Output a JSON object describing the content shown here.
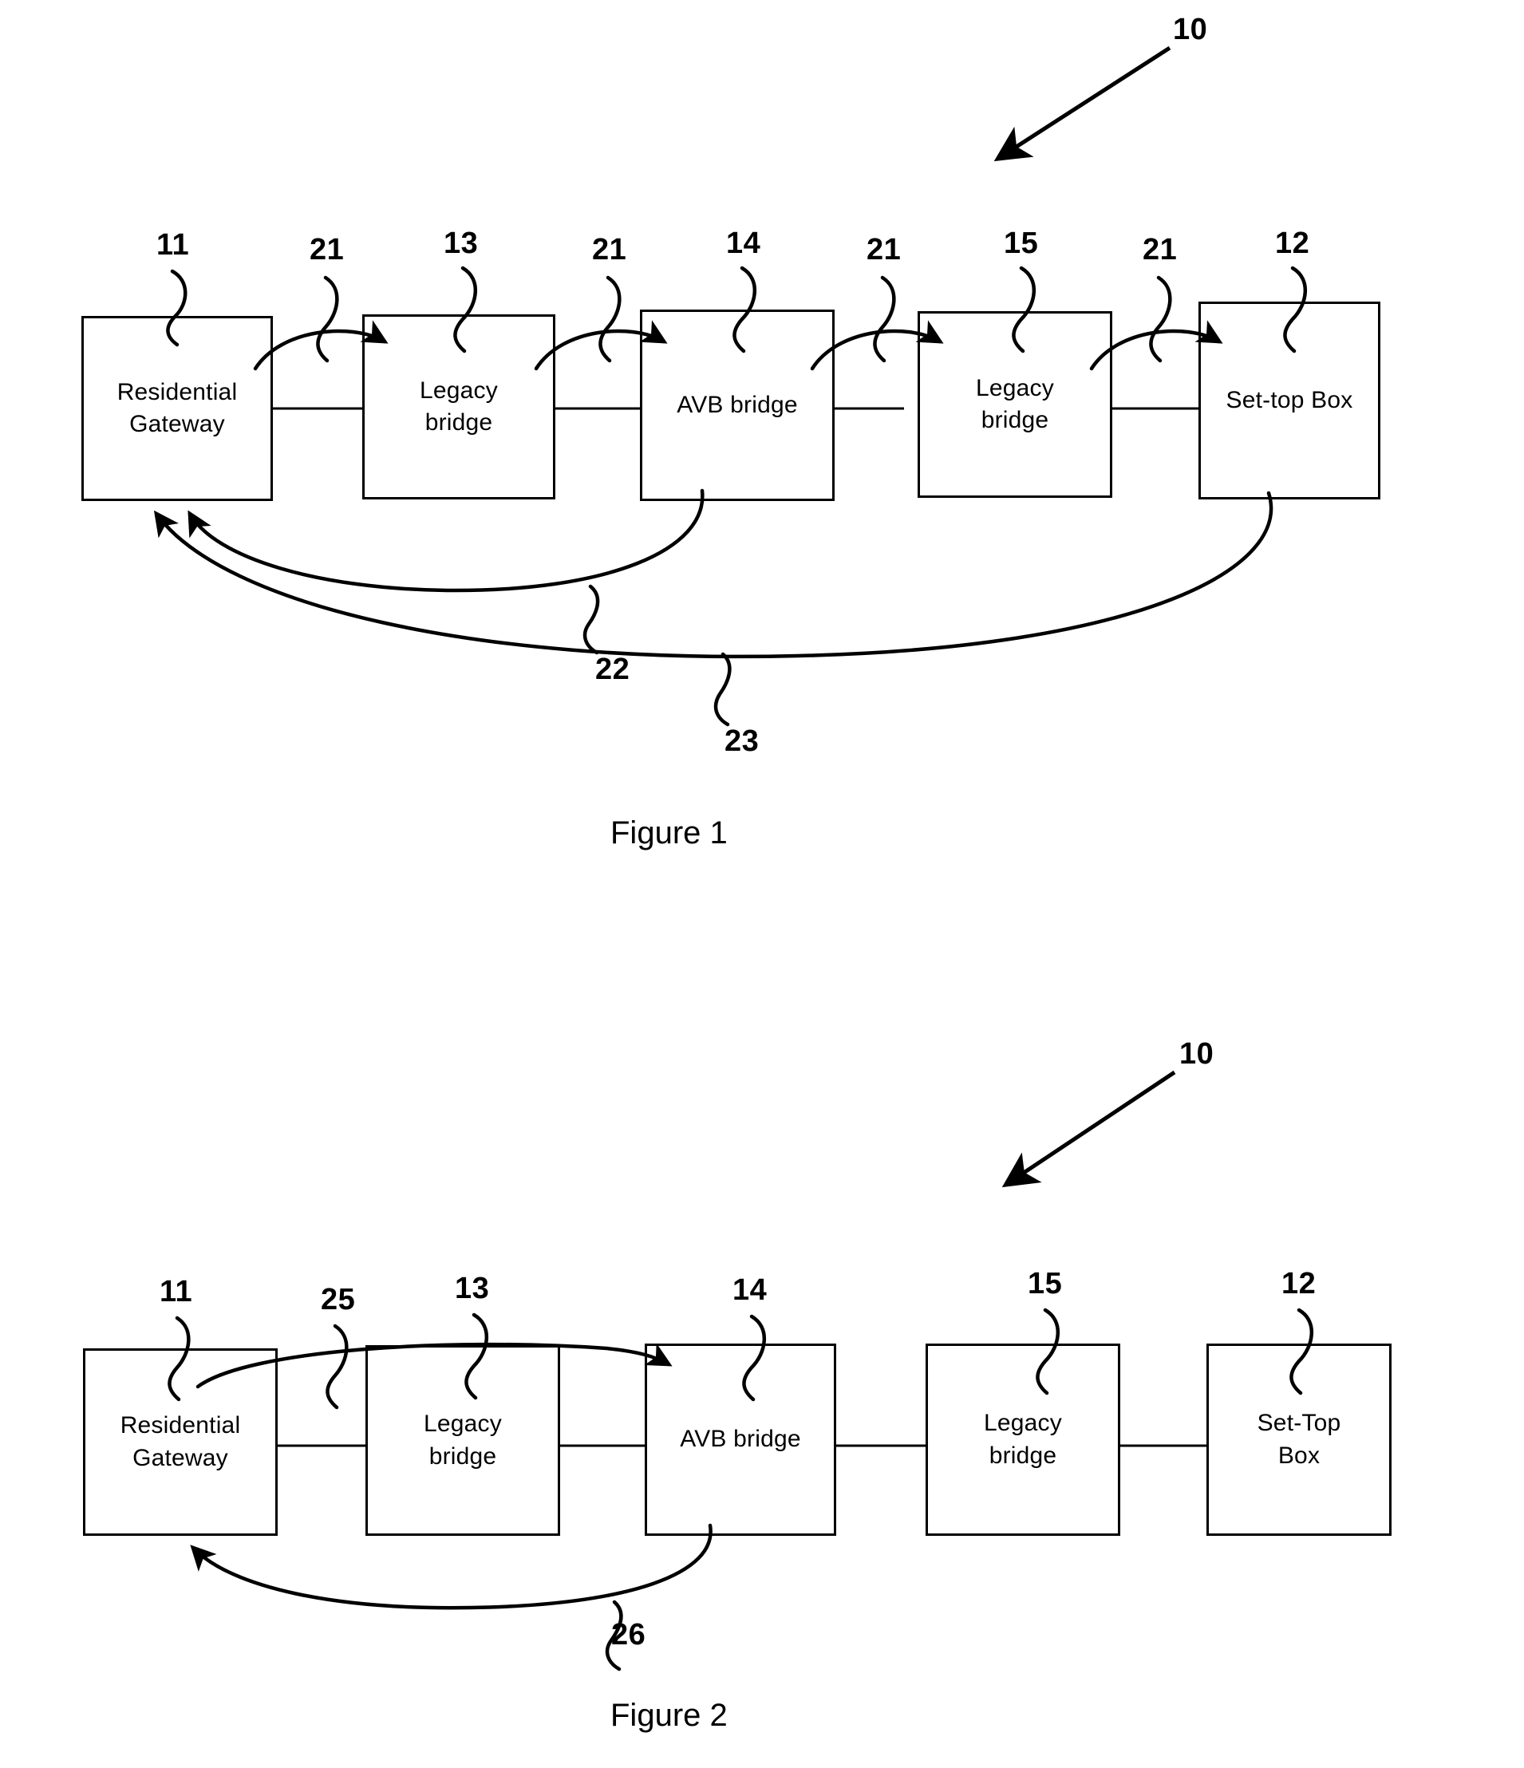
{
  "document": {
    "type": "patent-drawing-sheet",
    "background_color": "#ffffff",
    "ink_color": "#000000"
  },
  "figures": [
    {
      "id": "figure-1",
      "caption": "Figure 1",
      "system_ref": "10",
      "nodes": [
        {
          "ref": "11",
          "label": "Residential\nGateway"
        },
        {
          "ref": "13",
          "label": "Legacy\nbridge"
        },
        {
          "ref": "14",
          "label": "AVB bridge"
        },
        {
          "ref": "15",
          "label": "Legacy\nbridge"
        },
        {
          "ref": "12",
          "label": "Set-top Box"
        }
      ],
      "hop_refs": [
        "21",
        "21",
        "21",
        "21"
      ],
      "return_path_refs": [
        "22",
        "23"
      ]
    },
    {
      "id": "figure-2",
      "caption": "Figure 2",
      "system_ref": "10",
      "nodes": [
        {
          "ref": "11",
          "label": "Residential\nGateway"
        },
        {
          "ref": "13",
          "label": "Legacy\nbridge"
        },
        {
          "ref": "14",
          "label": "AVB bridge"
        },
        {
          "ref": "15",
          "label": "Legacy\nbridge"
        },
        {
          "ref": "12",
          "label": "Set-Top\nBox"
        }
      ],
      "forward_path_ref": "25",
      "return_path_ref": "26"
    }
  ],
  "f1": {
    "n0": "Residential\nGateway",
    "n1": "Legacy\nbridge",
    "n2": "AVB bridge",
    "n3": "Legacy\nbridge",
    "n4": "Set-top Box",
    "r0": "11",
    "r1": "13",
    "r2": "14",
    "r3": "15",
    "r4": "12",
    "h0": "21",
    "h1": "21",
    "h2": "21",
    "h3": "21",
    "p22": "22",
    "p23": "23",
    "sys": "10",
    "caption": "Figure 1"
  },
  "f2": {
    "n0": "Residential\nGateway",
    "n1": "Legacy\nbridge",
    "n2": "AVB bridge",
    "n3": "Legacy\nbridge",
    "n4": "Set-Top\nBox",
    "r0": "11",
    "r1": "13",
    "r2": "14",
    "r3": "15",
    "r4": "12",
    "p25": "25",
    "p26": "26",
    "sys": "10",
    "caption": "Figure 2"
  }
}
